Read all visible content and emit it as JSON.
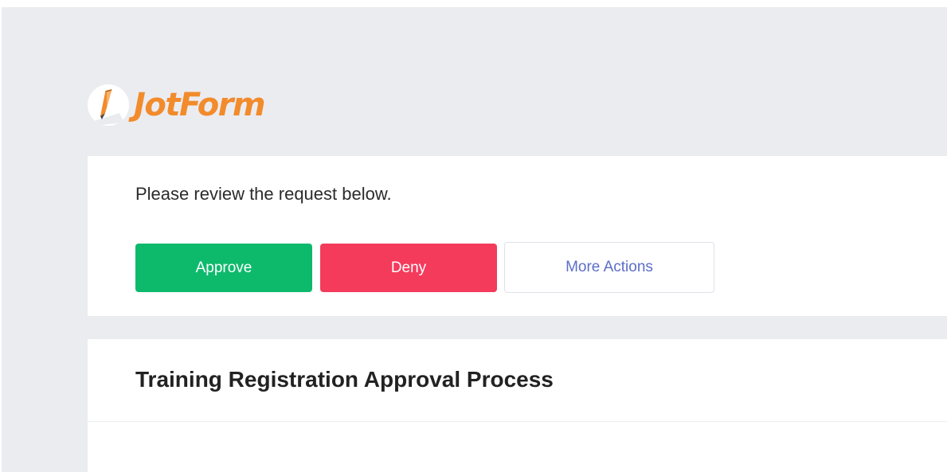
{
  "brand": {
    "name": "JotForm",
    "color": "#f28b2c"
  },
  "review": {
    "message": "Please review the request below.",
    "approve_label": "Approve",
    "deny_label": "Deny",
    "more_actions_label": "More Actions"
  },
  "colors": {
    "approve": "#0dba6c",
    "deny": "#f43b5c",
    "more_actions_text": "#5b6fc8",
    "background": "#ebecf0"
  },
  "form": {
    "title": "Training Registration Approval Process"
  }
}
